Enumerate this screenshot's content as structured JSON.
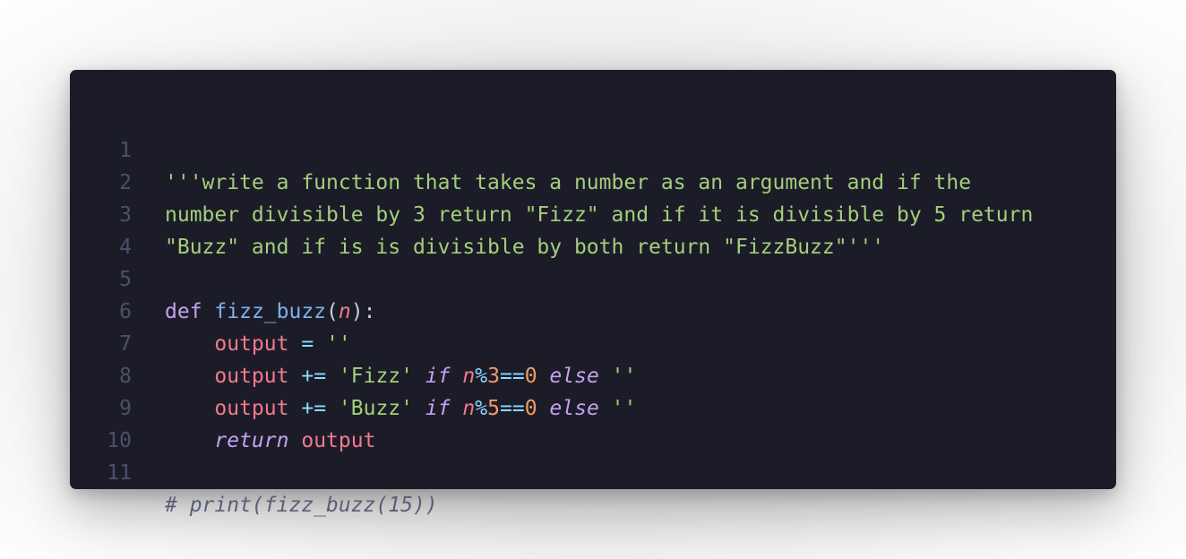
{
  "editor": {
    "lines": [
      {
        "number": "1",
        "tokens": [
          "'''write a function that takes a number as an argument and if the"
        ]
      },
      {
        "number": "2",
        "tokens": [
          "number divisible by 3 return \"Fizz\" and if it is divisible by 5 return"
        ]
      },
      {
        "number": "3",
        "tokens": [
          "\"Buzz\" and if is is divisible by both return \"FizzBuzz\"'''"
        ]
      },
      {
        "number": "4",
        "tokens": []
      },
      {
        "number": "5",
        "tokens": [
          "def",
          " ",
          "fizz_buzz",
          "(",
          "n",
          "):"
        ]
      },
      {
        "number": "6",
        "tokens": [
          "    ",
          "output",
          " ",
          "=",
          " ",
          "''"
        ]
      },
      {
        "number": "7",
        "tokens": [
          "    ",
          "output",
          " ",
          "+=",
          " ",
          "'Fizz'",
          " ",
          "if",
          " ",
          "n",
          "%",
          "3",
          "==",
          "0",
          " ",
          "else",
          " ",
          "''"
        ]
      },
      {
        "number": "8",
        "tokens": [
          "    ",
          "output",
          " ",
          "+=",
          " ",
          "'Buzz'",
          " ",
          "if",
          " ",
          "n",
          "%",
          "5",
          "==",
          "0",
          " ",
          "else",
          " ",
          "''"
        ]
      },
      {
        "number": "9",
        "tokens": [
          "    ",
          "return",
          " ",
          "output"
        ]
      },
      {
        "number": "10",
        "tokens": []
      },
      {
        "number": "11",
        "tokens": [
          "# print(fizz_buzz(15))"
        ]
      }
    ]
  },
  "colors": {
    "background": "#1c1c28",
    "line_number": "#4d5068",
    "string": "#a3cf7a",
    "keyword": "#c3a2f2",
    "function": "#7fb0ef",
    "variable": "#f07a8c",
    "operator": "#89ddff",
    "number": "#f29b64",
    "comment": "#5a5e78"
  }
}
